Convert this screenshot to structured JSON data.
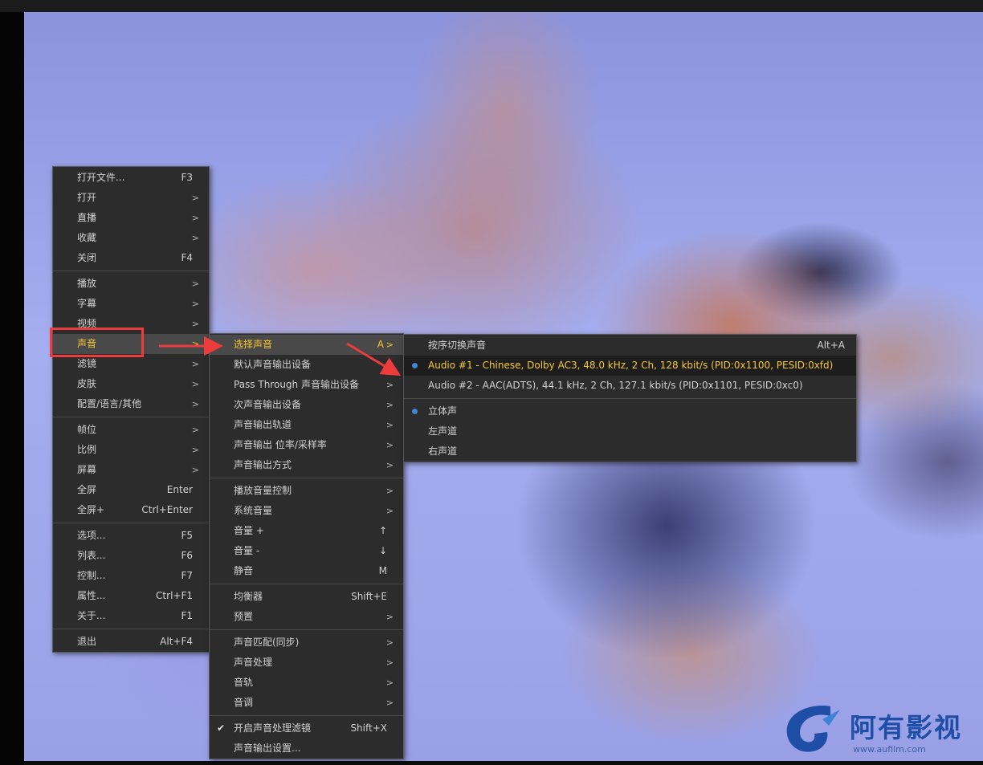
{
  "main_menu": {
    "items": [
      {
        "label": "打开文件...",
        "shortcut": "F3"
      },
      {
        "label": "打开",
        "shortcut": ">"
      },
      {
        "label": "直播",
        "shortcut": ">"
      },
      {
        "label": "收藏",
        "shortcut": ">"
      },
      {
        "label": "关闭",
        "shortcut": "F4"
      },
      {
        "label": "播放",
        "shortcut": ">"
      },
      {
        "label": "字幕",
        "shortcut": ">"
      },
      {
        "label": "视频",
        "shortcut": ">"
      },
      {
        "label": "声音",
        "shortcut": ">"
      },
      {
        "label": "滤镜",
        "shortcut": ">"
      },
      {
        "label": "皮肤",
        "shortcut": ">"
      },
      {
        "label": "配置/语言/其他",
        "shortcut": ">"
      },
      {
        "label": "帧位",
        "shortcut": ">"
      },
      {
        "label": "比例",
        "shortcut": ">"
      },
      {
        "label": "屏幕",
        "shortcut": ">"
      },
      {
        "label": "全屏",
        "shortcut": "Enter"
      },
      {
        "label": "全屏+",
        "shortcut": "Ctrl+Enter"
      },
      {
        "label": "选项...",
        "shortcut": "F5"
      },
      {
        "label": "列表...",
        "shortcut": "F6"
      },
      {
        "label": "控制...",
        "shortcut": "F7"
      },
      {
        "label": "属性...",
        "shortcut": "Ctrl+F1"
      },
      {
        "label": "关于...",
        "shortcut": "F1"
      },
      {
        "label": "退出",
        "shortcut": "Alt+F4"
      }
    ]
  },
  "sound_menu": {
    "items": [
      {
        "label": "选择声音",
        "shortcut": "A",
        "arrow": ">"
      },
      {
        "label": "默认声音输出设备",
        "arrow": ">"
      },
      {
        "label": "Pass Through 声音输出设备",
        "arrow": ">"
      },
      {
        "label": "次声音输出设备",
        "arrow": ">"
      },
      {
        "label": "声音输出轨道",
        "arrow": ">"
      },
      {
        "label": "声音输出 位率/采样率",
        "arrow": ">"
      },
      {
        "label": "声音输出方式",
        "arrow": ">"
      },
      {
        "label": "播放音量控制",
        "arrow": ">"
      },
      {
        "label": "系统音量",
        "arrow": ">"
      },
      {
        "label": "音量 +",
        "shortcut": "↑"
      },
      {
        "label": "音量 -",
        "shortcut": "↓"
      },
      {
        "label": "静音",
        "shortcut": "M"
      },
      {
        "label": "均衡器",
        "shortcut": "Shift+E"
      },
      {
        "label": "预置",
        "arrow": ">"
      },
      {
        "label": "声音匹配(同步)",
        "arrow": ">"
      },
      {
        "label": "声音处理",
        "arrow": ">"
      },
      {
        "label": "音轨",
        "arrow": ">"
      },
      {
        "label": "音调",
        "arrow": ">"
      },
      {
        "label": "开启声音处理滤镜",
        "shortcut": "Shift+X",
        "checked": true
      },
      {
        "label": "声音输出设置..."
      }
    ]
  },
  "audio_select_menu": {
    "items": [
      {
        "label": "按序切换声音",
        "shortcut": "Alt+A"
      },
      {
        "label": "Audio #1 - Chinese, Dolby AC3, 48.0 kHz, 2 Ch, 128 kbit/s (PID:0x1100, PESID:0xfd)",
        "selected": true
      },
      {
        "label": "Audio #2 - AAC(ADTS), 44.1 kHz, 2 Ch, 127.1 kbit/s (PID:0x1101, PESID:0xc0)"
      },
      {
        "label": "立体声",
        "selected": true
      },
      {
        "label": "左声道"
      },
      {
        "label": "右声道"
      }
    ]
  },
  "watermark": {
    "name": "阿有影视",
    "url": "www.aufilm.com"
  },
  "colors": {
    "highlight_text": "#f7c831",
    "menu_bg": "#2c2c2c",
    "annotation_red": "#ee3b3b",
    "radio_dot": "#3f87d4",
    "logo_blue": "#1e4ea6"
  }
}
